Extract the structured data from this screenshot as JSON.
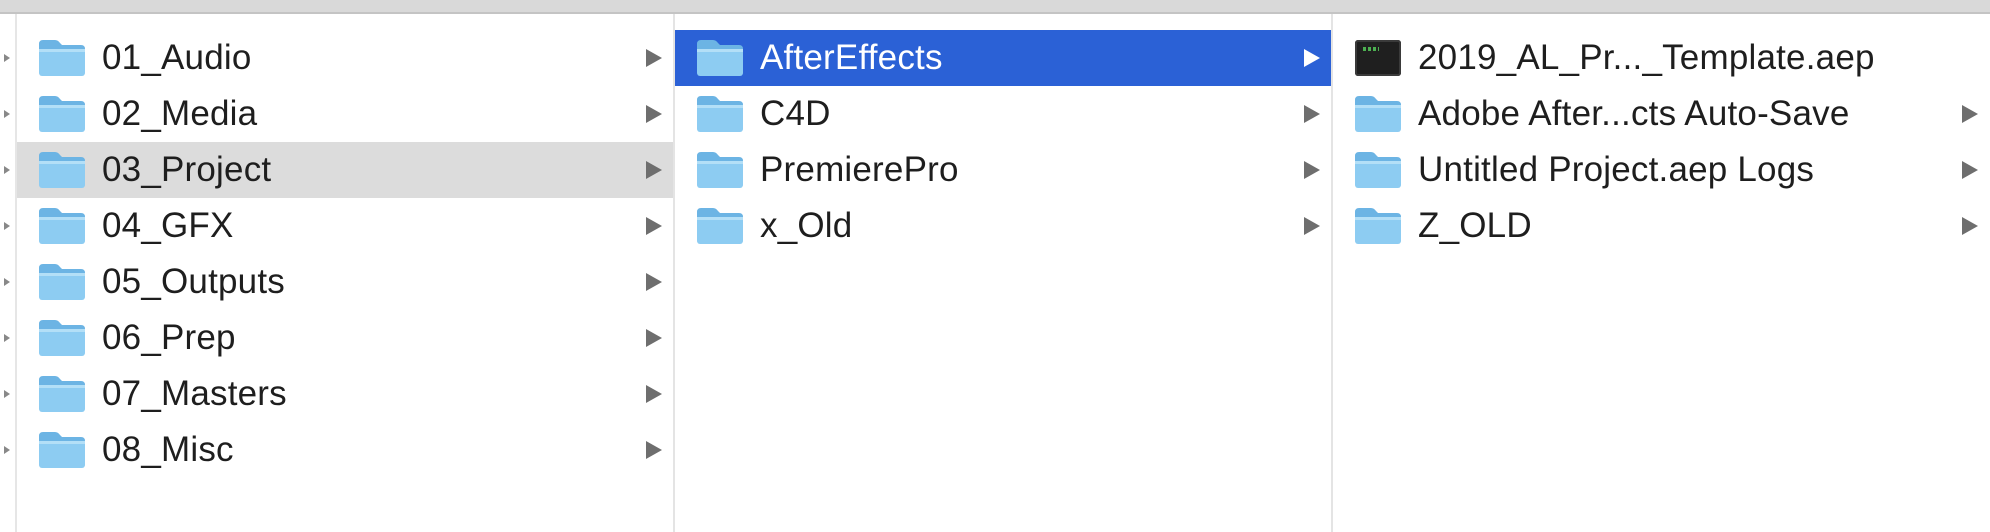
{
  "colors": {
    "selection_blue": "#2b61d6",
    "selection_gray": "#dcdcdc",
    "folder_blue": "#7ec3ee"
  },
  "columns": [
    {
      "items": [
        {
          "label": "01_Audio",
          "icon": "folder-icon",
          "has_children": true,
          "state": "none"
        },
        {
          "label": "02_Media",
          "icon": "folder-icon",
          "has_children": true,
          "state": "none"
        },
        {
          "label": "03_Project",
          "icon": "folder-icon",
          "has_children": true,
          "state": "inactive-selected"
        },
        {
          "label": "04_GFX",
          "icon": "folder-icon",
          "has_children": true,
          "state": "none"
        },
        {
          "label": "05_Outputs",
          "icon": "folder-icon",
          "has_children": true,
          "state": "none"
        },
        {
          "label": "06_Prep",
          "icon": "folder-icon",
          "has_children": true,
          "state": "none"
        },
        {
          "label": "07_Masters",
          "icon": "folder-icon",
          "has_children": true,
          "state": "none"
        },
        {
          "label": "08_Misc",
          "icon": "folder-icon",
          "has_children": true,
          "state": "none"
        }
      ]
    },
    {
      "items": [
        {
          "label": "AfterEffects",
          "icon": "folder-icon",
          "has_children": true,
          "state": "active-selected"
        },
        {
          "label": "C4D",
          "icon": "folder-icon",
          "has_children": true,
          "state": "none"
        },
        {
          "label": "PremierePro",
          "icon": "folder-icon",
          "has_children": true,
          "state": "none"
        },
        {
          "label": "x_Old",
          "icon": "folder-icon",
          "has_children": true,
          "state": "none"
        }
      ]
    },
    {
      "items": [
        {
          "label": "2019_AL_Pr..._Template.aep",
          "icon": "aep-file-icon",
          "has_children": false,
          "state": "none"
        },
        {
          "label": "Adobe After...cts Auto-Save",
          "icon": "folder-icon",
          "has_children": true,
          "state": "none"
        },
        {
          "label": "Untitled Project.aep Logs",
          "icon": "folder-icon",
          "has_children": true,
          "state": "none"
        },
        {
          "label": "Z_OLD",
          "icon": "folder-icon",
          "has_children": true,
          "state": "none"
        }
      ]
    }
  ]
}
